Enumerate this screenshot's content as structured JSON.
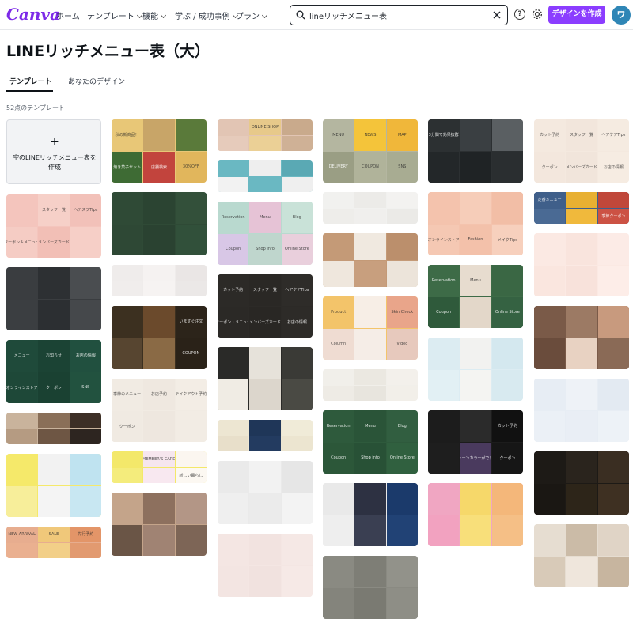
{
  "header": {
    "logo": "Canva",
    "nav": [
      {
        "label": "ホーム",
        "chevron": false
      },
      {
        "label": "テンプレート",
        "chevron": true
      },
      {
        "label": "機能",
        "chevron": true
      },
      {
        "label": "学ぶ / 成功事例",
        "chevron": true
      },
      {
        "label": "プラン",
        "chevron": true
      }
    ],
    "search_query": "lineリッチメニュー表",
    "help_label": "?",
    "cta_label": "デザインを作成",
    "avatar_initial": "ワ",
    "accent": "#8b3dff"
  },
  "page": {
    "title": "LINEリッチメニュー表（大）",
    "tabs": [
      {
        "label": "テンプレート",
        "active": true
      },
      {
        "label": "あなたのデザイン",
        "active": false
      }
    ],
    "count": "52点のテンプレート",
    "blank_card": {
      "plus": "+",
      "label": "空のLINEリッチメニュー表を作成"
    }
  },
  "templates": [
    {
      "col": 0,
      "colors": [
        "#f4c5bd",
        "#f6d0c8",
        "#f2c1b9",
        "#f5ccc4",
        "#f2bfb6",
        "#f6cfc7"
      ],
      "labels": [
        "",
        "スタッフ一覧",
        "ヘアスプTips",
        "クーポン＆メニュー",
        "メンバーズカード",
        ""
      ]
    },
    {
      "col": 0,
      "colors": [
        "#3a3d40",
        "#2d3033",
        "#4a4d50",
        "#3b3e41",
        "#2c2f32",
        "#45484b"
      ],
      "labels": [
        "",
        "",
        "",
        "",
        "",
        ""
      ]
    },
    {
      "col": 0,
      "colors": [
        "#1f4a3a",
        "#1b4334",
        "#21503f",
        "#1e4838",
        "#1a4132",
        "#22523f"
      ],
      "labels": [
        "メニュー",
        "お知らせ",
        "お店の情報",
        "オンラインストア",
        "クーポン",
        "SNS"
      ]
    },
    {
      "col": 0,
      "colors": [
        "#c9b39c",
        "#8a6f58",
        "#3d2f26",
        "#b59b82",
        "#6e5644",
        "#2d2520"
      ],
      "labels": [
        "",
        "",
        "",
        "",
        "",
        ""
      ]
    },
    {
      "col": 0,
      "colors": [
        "#f5e96a",
        "#f2f2f2",
        "#bfe3f0",
        "#f7ee9a",
        "#f4f4f4",
        "#c8e7f2"
      ],
      "labels": [
        "",
        "",
        "",
        "",
        "",
        ""
      ]
    },
    {
      "col": 0,
      "colors": [
        "#e7ad8f",
        "#f0c87a",
        "#e39568",
        "#eab090",
        "#f2cf88",
        "#e29a70"
      ],
      "labels": [
        "NEW ARRIVAL",
        "SALE",
        "先行予約",
        "",
        "",
        ""
      ]
    },
    {
      "col": 1,
      "colors": [
        "#e8c777",
        "#c8a568",
        "#5a7a3a",
        "#3e6b34",
        "#c2443d",
        "#e1b65c"
      ],
      "labels": [
        "秋の新商品！",
        "",
        "",
        "焼き菓子セット",
        "店舗検索",
        "30%OFF"
      ]
    },
    {
      "col": 1,
      "colors": [
        "#2f4a36",
        "#2b4432",
        "#33503a",
        "#2e4835",
        "#2a4231",
        "#31503a"
      ],
      "labels": [
        "",
        "",
        "",
        "",
        "",
        ""
      ]
    },
    {
      "col": 1,
      "colors": [
        "#efeceb",
        "#f5f2f1",
        "#eae6e5",
        "#f0edec",
        "#f6f3f2",
        "#ebe8e7"
      ],
      "labels": [
        "",
        "",
        "",
        "",
        "",
        ""
      ]
    },
    {
      "col": 1,
      "colors": [
        "#3c3020",
        "#6b4a2c",
        "#2c241a",
        "#574530",
        "#8a6a45",
        "#2a2218"
      ],
      "labels": [
        "",
        "",
        "いますぐ注文",
        "",
        "",
        "COUPON"
      ]
    },
    {
      "col": 1,
      "colors": [
        "#f1ebe3",
        "#efe8e0",
        "#f3ede5",
        "#f0eae2",
        "#eee7df",
        "#f2ece4"
      ],
      "labels": [
        "季節のメニュー",
        "お店予約",
        "テイクアウト予約",
        "クーポン",
        "",
        ""
      ]
    },
    {
      "col": 1,
      "colors": [
        "#f3e86a",
        "#f6e6ee",
        "#fbf6f0",
        "#f4ec7c",
        "#f8e8f0",
        "#fcf8f2"
      ],
      "labels": [
        "",
        "MEMBER'S CARD",
        "",
        "",
        "",
        "新しい暮らし"
      ]
    },
    {
      "col": 1,
      "colors": [
        "#c4a48a",
        "#8d705e",
        "#b39686",
        "#6a5546",
        "#a08373",
        "#7d6556"
      ],
      "labels": [
        "",
        "",
        "",
        "",
        "",
        ""
      ]
    },
    {
      "col": 2,
      "colors": [
        "#e2c5b4",
        "#e7c98a",
        "#c9aa8c",
        "#e6cbbb",
        "#ebd096",
        "#cfb196"
      ],
      "labels": [
        "",
        "ONLINE SHOP",
        "",
        "",
        "",
        ""
      ]
    },
    {
      "col": 2,
      "colors": [
        "#6ab8c2",
        "#eeeeee",
        "#5aa9b4",
        "#f2f2f2",
        "#6ab8c2",
        "#efefef"
      ],
      "labels": [
        "",
        "",
        "",
        "",
        "",
        ""
      ]
    },
    {
      "col": 2,
      "colors": [
        "#b9d9cf",
        "#e6c3d6",
        "#c9e2d8",
        "#d8c7e6",
        "#bfd6cd",
        "#e9cfdc"
      ],
      "labels": [
        "Reservation",
        "Menu",
        "Blog",
        "Coupon",
        "Shop info",
        "Online Store"
      ]
    },
    {
      "col": 2,
      "colors": [
        "#2c2a27",
        "#2a2825",
        "#2e2c29",
        "#2b2926",
        "#292724",
        "#2d2b28"
      ],
      "labels": [
        "カット予約",
        "スタッフ一覧",
        "ヘアケアTips",
        "クーポン・メニュー",
        "メンバーズカード",
        "お店の情報"
      ]
    },
    {
      "col": 2,
      "colors": [
        "#2a2a28",
        "#e6e2da",
        "#3a3a36",
        "#f0ece4",
        "#dcd6cc",
        "#4a4a44"
      ],
      "labels": [
        "",
        "",
        "",
        "",
        "",
        ""
      ]
    },
    {
      "col": 2,
      "colors": [
        "#ede6d2",
        "#1f3658",
        "#f0ebd8",
        "#e8dfca",
        "#233b60",
        "#ece5d0"
      ],
      "labels": [
        "",
        "",
        "",
        "",
        "",
        ""
      ]
    },
    {
      "col": 2,
      "colors": [
        "#eaeaea",
        "#f2f2f2",
        "#e6e6e6",
        "#efefef",
        "#ebebeb",
        "#f3f3f3"
      ],
      "labels": [
        "",
        "",
        "",
        "",
        "",
        ""
      ]
    },
    {
      "col": 2,
      "colors": [
        "#f4e6e3",
        "#f2e3e0",
        "#f5e8e5",
        "#f3e5e2",
        "#f1e2df",
        "#f6e9e6"
      ],
      "labels": [
        "",
        "",
        "",
        "",
        "",
        ""
      ]
    },
    {
      "col": 3,
      "colors": [
        "#b4b6a0",
        "#f4c43a",
        "#f0b73a",
        "#9a9e84",
        "#b0b39a",
        "#a8ac92"
      ],
      "labels": [
        "MENU",
        "NEWS",
        "MAP",
        "DELIVERY",
        "COUPON",
        "SNS"
      ]
    },
    {
      "col": 3,
      "colors": [
        "#f1f1ef",
        "#ecebe8",
        "#f3f2f0",
        "#eeedea",
        "#f0efed",
        "#ebeae7"
      ],
      "labels": [
        "",
        "",
        "",
        "",
        "",
        ""
      ]
    },
    {
      "col": 3,
      "colors": [
        "#c49a77",
        "#f0e9e0",
        "#bb8f6c",
        "#efe7dd",
        "#c89f7e",
        "#ece4da"
      ],
      "labels": [
        "",
        "",
        "",
        "",
        "",
        ""
      ]
    },
    {
      "col": 3,
      "colors": [
        "#f3c46a",
        "#f7eee6",
        "#e9a58a",
        "#efdcd2",
        "#f5ede7",
        "#e7c9bd"
      ],
      "labels": [
        "Product",
        "",
        "Skin Check",
        "Column",
        "",
        "Video"
      ]
    },
    {
      "col": 3,
      "colors": [
        "#f1efea",
        "#ebe8e1",
        "#f3f0eb",
        "#eeebe5",
        "#e8e5de",
        "#f2efe9"
      ],
      "labels": [
        "",
        "",
        "",
        "",
        "",
        ""
      ]
    },
    {
      "col": 3,
      "colors": [
        "#2e5a3c",
        "#2a5438",
        "#315e40",
        "#2c5739",
        "#285136",
        "#30603f"
      ],
      "labels": [
        "Reservation",
        "Menu",
        "Blog",
        "Coupon",
        "Shop info",
        "Online Store"
      ]
    },
    {
      "col": 3,
      "colors": [
        "#e9e9e9",
        "#2d3142",
        "#1b3a6b",
        "#eeeeee",
        "#3a3f52",
        "#214275"
      ],
      "labels": [
        "",
        "",
        "",
        "",
        "",
        ""
      ]
    },
    {
      "col": 3,
      "colors": [
        "#8a8a82",
        "#7e7e76",
        "#92928a",
        "#84847c",
        "#7a7a72",
        "#8e8e86"
      ],
      "labels": [
        "",
        "",
        "",
        "",
        "",
        ""
      ]
    },
    {
      "col": 4,
      "colors": [
        "#2c3032",
        "#3a3f42",
        "#5a5f62",
        "#232729",
        "#1f2325",
        "#2a2e30"
      ],
      "labels": [
        "3分間で効果抜群",
        "",
        "",
        "",
        "",
        ""
      ]
    },
    {
      "col": 4,
      "colors": [
        "#f4c3ad",
        "#f6cdb9",
        "#f2bea6",
        "#f5c8b3",
        "#f3c1aa",
        "#f7d0bd"
      ],
      "labels": [
        "",
        "",
        "",
        "オンラインストア",
        "Fashion",
        "メイクTips"
      ]
    },
    {
      "col": 4,
      "colors": [
        "#3d6b47",
        "#e7dccf",
        "#3a6744",
        "#2f5a3b",
        "#e3d7c9",
        "#356242"
      ],
      "labels": [
        "Reservation",
        "Menu",
        "",
        "Coupon",
        "",
        "Online Store"
      ]
    },
    {
      "col": 4,
      "colors": [
        "#dcecf2",
        "#f2f2f0",
        "#d4e8ef",
        "#e2f0f4",
        "#f4f4f2",
        "#d8eaf0"
      ],
      "labels": [
        "",
        "",
        "",
        "",
        "",
        ""
      ]
    },
    {
      "col": 4,
      "colors": [
        "#1c1c1c",
        "#2b2b2b",
        "#111111",
        "#1e1e1e",
        "#4a3a5e",
        "#161616"
      ],
      "labels": [
        "",
        "",
        "カット予約",
        "",
        "ハイトーンカラーができる！",
        "クーポン"
      ]
    },
    {
      "col": 4,
      "colors": [
        "#f0a6c2",
        "#f6d86a",
        "#f4b77a",
        "#f2a2c0",
        "#f8df7a",
        "#f5bf86"
      ],
      "labels": [
        "",
        "",
        "",
        "",
        "",
        ""
      ]
    },
    {
      "col": 5,
      "colors": [
        "#f4e9df",
        "#f2e6dc",
        "#f5ebe1",
        "#f3e7dd",
        "#f1e5db",
        "#f6ece2"
      ],
      "labels": [
        "カット予約",
        "スタッフ一覧",
        "ヘアケアTips",
        "クーポン",
        "メンバーズカード",
        "お店の情報"
      ]
    },
    {
      "col": 5,
      "colors": [
        "#3f5f8a",
        "#e8b032",
        "#c0473a",
        "#4a6a94",
        "#f0b93c",
        "#cc5244"
      ],
      "labels": [
        "定番メニュー",
        "",
        "",
        "",
        "",
        "季節クーポン"
      ]
    },
    {
      "col": 5,
      "colors": [
        "#fbe9e3",
        "#f9e4dd",
        "#fcebe6",
        "#fae6df",
        "#f8e2db",
        "#fdede8"
      ],
      "labels": [
        "",
        "",
        "",
        "",
        "",
        ""
      ]
    },
    {
      "col": 5,
      "colors": [
        "#7a5a48",
        "#9c7a64",
        "#c89a7e",
        "#6a4c3c",
        "#e8d2c2",
        "#8a6a56"
      ],
      "labels": [
        "",
        "",
        "",
        "",
        "",
        ""
      ]
    },
    {
      "col": 5,
      "colors": [
        "#e7edf4",
        "#eef2f7",
        "#e3eaf2",
        "#ebf0f6",
        "#e9eef5",
        "#edf2f7"
      ],
      "labels": [
        "",
        "",
        "",
        "",
        "",
        ""
      ]
    },
    {
      "col": 5,
      "colors": [
        "#1d1a16",
        "#2a241d",
        "#3a2e22",
        "#1a1713",
        "#2d2519",
        "#3e3022"
      ],
      "labels": [
        "",
        "",
        "",
        "",
        "",
        ""
      ]
    },
    {
      "col": 5,
      "colors": [
        "#e6ddd1",
        "#cbbba7",
        "#e0d4c6",
        "#d8cab8",
        "#efe6dc",
        "#c7b59f"
      ],
      "labels": [
        "",
        "",
        "",
        "",
        "",
        ""
      ]
    }
  ]
}
